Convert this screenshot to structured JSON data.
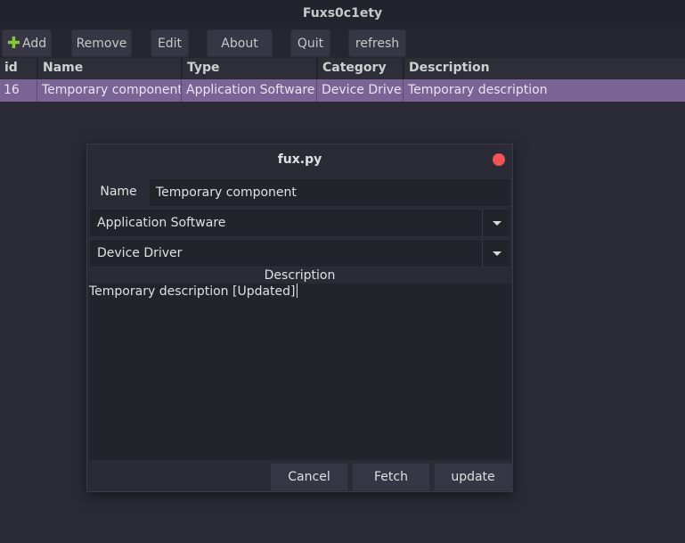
{
  "window": {
    "title": "Fuxs0c1ety"
  },
  "toolbar": {
    "add": "Add",
    "remove": "Remove",
    "edit": "Edit",
    "about": "About",
    "quit": "Quit",
    "refresh": "refresh"
  },
  "table": {
    "columns": [
      "id",
      "Name",
      "Type",
      "Category",
      "Description"
    ],
    "rows": [
      [
        "16",
        "Temporary component",
        "Application Software",
        "Device Driver",
        "Temporary description"
      ]
    ]
  },
  "dialog": {
    "title": "fux.py",
    "name_label": "Name",
    "name_value": "Temporary component",
    "type_value": "Application Software",
    "category_value": "Device Driver",
    "description_label": "Description",
    "description_value": "Temporary description [Updated]",
    "cancel": "Cancel",
    "fetch": "Fetch",
    "update": "update"
  },
  "colors": {
    "selection": "#7a6496",
    "close": "#f05454",
    "add_icon": "#8fc33a"
  }
}
